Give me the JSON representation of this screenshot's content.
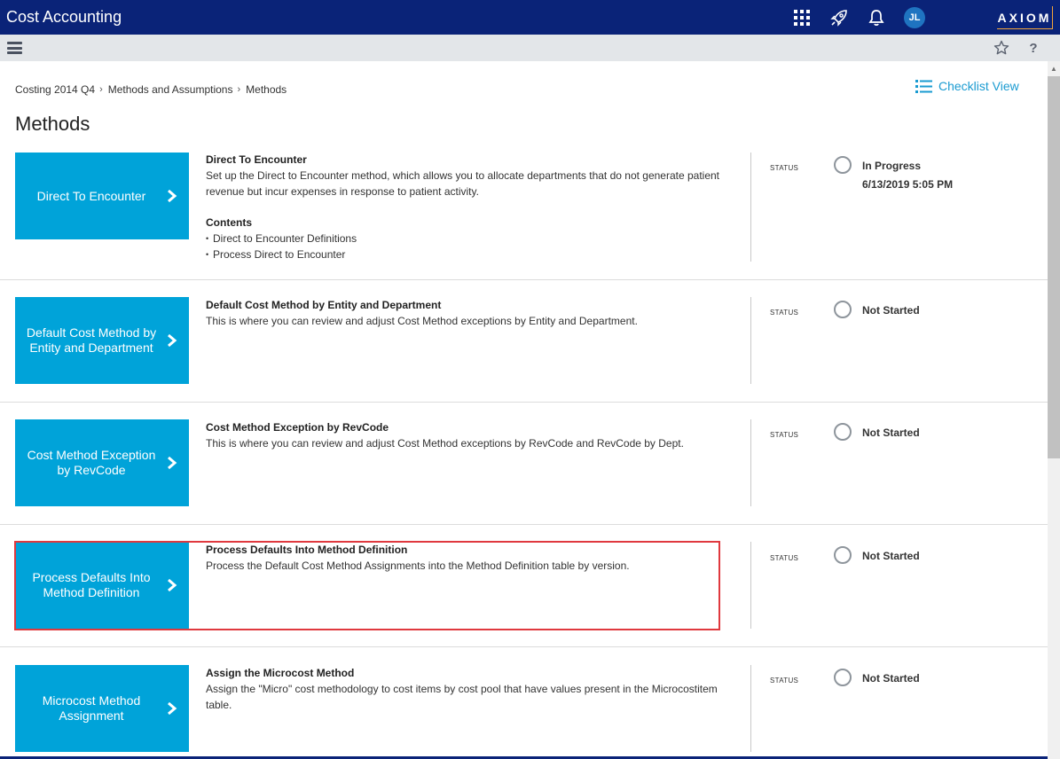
{
  "header": {
    "app_title": "Cost Accounting",
    "avatar_initials": "JL",
    "logo_text": "AXIOM",
    "colors": {
      "nav": "#0a2378",
      "accent": "#00a3d9",
      "logo_border": "#f2a43a"
    }
  },
  "subbar": {
    "icons": [
      "menu-icon",
      "star-icon",
      "help-icon"
    ],
    "help_label": "?"
  },
  "breadcrumb": {
    "items": [
      "Costing 2014 Q4",
      "Methods and Assumptions",
      "Methods"
    ],
    "separator": "›"
  },
  "checklist_view_label": "Checklist View",
  "page_title": "Methods",
  "status_heading": "STATUS",
  "methods": [
    {
      "tile_label": "Direct To Encounter",
      "title": "Direct To Encounter",
      "description": "Set up the Direct to Encounter method, which allows you to allocate departments that do not generate patient revenue but incur expenses in response to patient activity.",
      "contents_heading": "Contents",
      "contents": [
        "Direct to Encounter Definitions",
        "Process Direct to Encounter"
      ],
      "status": "In Progress",
      "status_date": "6/13/2019 5:05 PM"
    },
    {
      "tile_label": "Default Cost Method by Entity and Department",
      "title": "Default Cost Method by Entity and Department",
      "description": "This is where you can review and adjust Cost Method exceptions by Entity and Department.",
      "status": "Not Started"
    },
    {
      "tile_label": "Cost Method Exception by RevCode",
      "title": "Cost Method Exception by RevCode",
      "description": "This is where you can review and adjust Cost Method exceptions by RevCode and RevCode by Dept.",
      "status": "Not Started"
    },
    {
      "tile_label": "Process Defaults Into Method Definition",
      "title": "Process Defaults Into Method Definition",
      "description": "Process the Default Cost Method Assignments into the Method Definition table by version.",
      "status": "Not Started",
      "highlighted": true
    },
    {
      "tile_label": "Microcost Method Assignment",
      "title": "Assign the Microcost Method",
      "description": "Assign the \"Micro\" cost methodology to cost items by cost pool that have values present in the Microcostitem table.",
      "status": "Not Started"
    }
  ]
}
